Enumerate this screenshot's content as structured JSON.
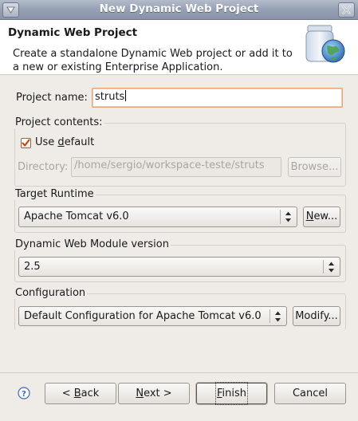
{
  "window": {
    "title": "New Dynamic Web Project"
  },
  "header": {
    "title": "Dynamic Web Project",
    "description": "Create a standalone Dynamic Web project or add it to a new or existing Enterprise Application."
  },
  "project_name": {
    "label": "Project name:",
    "value": "struts"
  },
  "project_contents": {
    "title": "Project contents:",
    "use_default": {
      "label_prefix": "Use ",
      "label_underlined": "d",
      "label_suffix": "efault",
      "checked": true
    },
    "directory_label": "Directory:",
    "directory_value": "/home/sergio/workspace-teste/struts",
    "browse_label": "Browse..."
  },
  "target_runtime": {
    "title": "Target Runtime",
    "selected": "Apache Tomcat v6.0",
    "new_button": {
      "underlined": "N",
      "rest": "ew..."
    }
  },
  "module_version": {
    "title": "Dynamic Web Module version",
    "selected": "2.5"
  },
  "configuration": {
    "title": "Configuration",
    "selected": "Default Configuration for Apache Tomcat v6.0",
    "modify_label": "Modify..."
  },
  "footer": {
    "back": {
      "prefix": "< ",
      "underlined": "B",
      "rest": "ack"
    },
    "next": {
      "underlined": "N",
      "rest": "ext >"
    },
    "finish": {
      "underlined": "F",
      "rest": "inish"
    },
    "cancel": "Cancel"
  },
  "icons": {
    "window_menu": "triangle-down-icon",
    "close": "close-icon",
    "wizard_banner": "web-project-globe-jar-icon",
    "help": "help-question-icon",
    "combo_arrows": "up-down-arrows-icon"
  },
  "colors": {
    "titlebar": "#949eb2",
    "focus_border": "#e0a37a",
    "checkbox_mark": "#c2410c",
    "help_blue": "#3b6cb5"
  }
}
